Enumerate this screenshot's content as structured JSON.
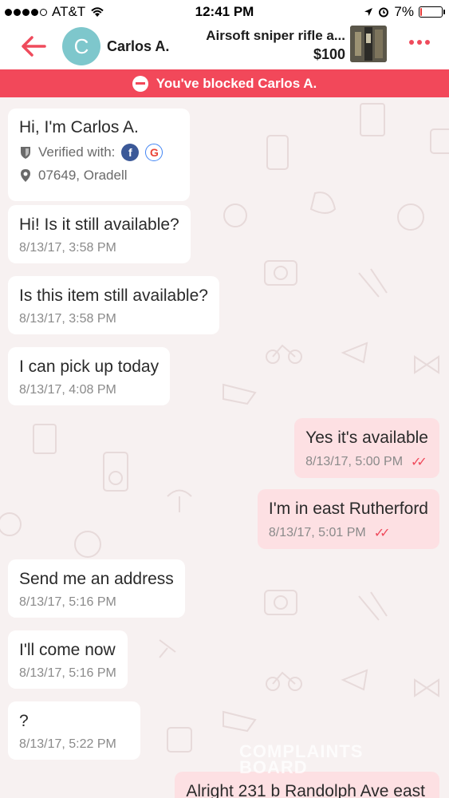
{
  "status_bar": {
    "carrier": "AT&T",
    "time": "12:41 PM",
    "battery": "7%",
    "battery_level": 0.07,
    "icons": [
      "signal-dots",
      "wifi-icon",
      "location-arrow-icon",
      "alarm-icon",
      "battery-icon"
    ]
  },
  "header": {
    "avatar_letter": "C",
    "contact_name": "Carlos A.",
    "item_title": "Airsoft sniper rifle a...",
    "item_price": "$100"
  },
  "banner": {
    "text": "You've blocked Carlos A."
  },
  "profile": {
    "title": "Hi, I'm Carlos A.",
    "verified_label": "Verified with:",
    "location": "07649, Oradell"
  },
  "messages": [
    {
      "text": "Hi! Is it still available?",
      "time": "8/13/17, 3:58 PM",
      "side": "in"
    },
    {
      "text": "Is this item still available?",
      "time": "8/13/17, 3:58 PM",
      "side": "in"
    },
    {
      "text": "I can pick up today",
      "time": "8/13/17, 4:08 PM",
      "side": "in"
    },
    {
      "text": "Yes it's available",
      "time": "8/13/17, 5:00 PM",
      "side": "out"
    },
    {
      "text": "I'm in east Rutherford",
      "time": "8/13/17, 5:01 PM",
      "side": "out"
    },
    {
      "text": "Send me an address",
      "time": "8/13/17, 5:16 PM",
      "side": "in"
    },
    {
      "text": "I'll come now",
      "time": "8/13/17, 5:16 PM",
      "side": "in"
    },
    {
      "text": "?",
      "time": "8/13/17, 5:22 PM",
      "side": "in"
    },
    {
      "text": "Alright 231 b Randolph Ave east",
      "time": "",
      "side": "out"
    }
  ],
  "watermark": {
    "line1": "COMPLAINTS",
    "line2": "BOARD"
  },
  "colors": {
    "accent": "#ef4b5c",
    "banner": "#f2485a",
    "outgoing_bubble": "#fde0e3",
    "avatar": "#7ec7cc",
    "background": "#f7f1f1"
  }
}
